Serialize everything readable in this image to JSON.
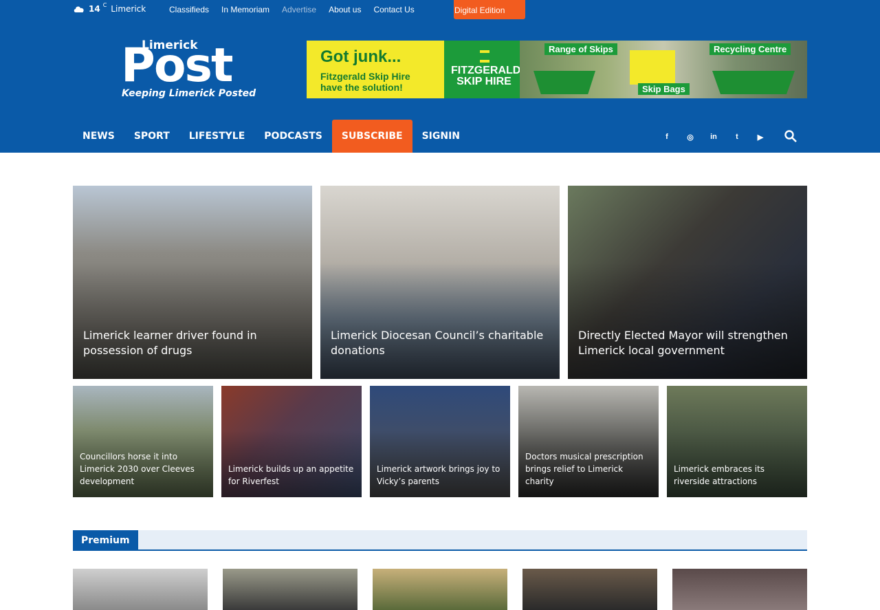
{
  "topbar": {
    "weather_temp": "14",
    "weather_unit": "C",
    "weather_city": "Limerick",
    "links": [
      "Classifieds",
      "In Memoriam",
      "Advertise",
      "About us",
      "Contact Us"
    ],
    "digital_edition": "Digital Edition"
  },
  "logo": {
    "small": "Limerick",
    "big": "Post",
    "tagline": "Keeping Limerick Posted"
  },
  "banner": {
    "headline": "Got junk...",
    "sub_line1": "Fitzgerald Skip Hire",
    "sub_line2": "have the solution!",
    "brand_line1": "FITZGERALD",
    "brand_line2": "SKIP HIRE",
    "label_range": "Range of Skips",
    "label_recycling": "Recycling Centre",
    "label_bags": "Skip Bags"
  },
  "nav": {
    "items": [
      "NEWS",
      "SPORT",
      "LIFESTYLE",
      "PODCASTS",
      "SUBSCRIBE",
      "SIGNIN"
    ]
  },
  "social": {
    "facebook": "f",
    "instagram": "◎",
    "linkedin": "in",
    "twitter": "t",
    "youtube": "▶"
  },
  "featured_big": [
    {
      "title": "Limerick learner driver found in possession of drugs"
    },
    {
      "title": "Limerick Diocesan Council’s charitable donations"
    },
    {
      "title": "Directly Elected Mayor will strengthen Limerick local government"
    }
  ],
  "featured_small": [
    {
      "title": "Councillors horse it into Limerick 2030 over Cleeves development"
    },
    {
      "title": "Limerick builds up an appetite for Riverfest"
    },
    {
      "title": "Limerick artwork brings joy to Vicky’s parents"
    },
    {
      "title": "Doctors musical prescription brings relief to Limerick charity"
    },
    {
      "title": "Limerick embraces its riverside attractions"
    }
  ],
  "premium": {
    "label": "Premium"
  },
  "colors": {
    "brand_blue": "#0a5aa8",
    "accent_orange": "#f25c1f"
  }
}
